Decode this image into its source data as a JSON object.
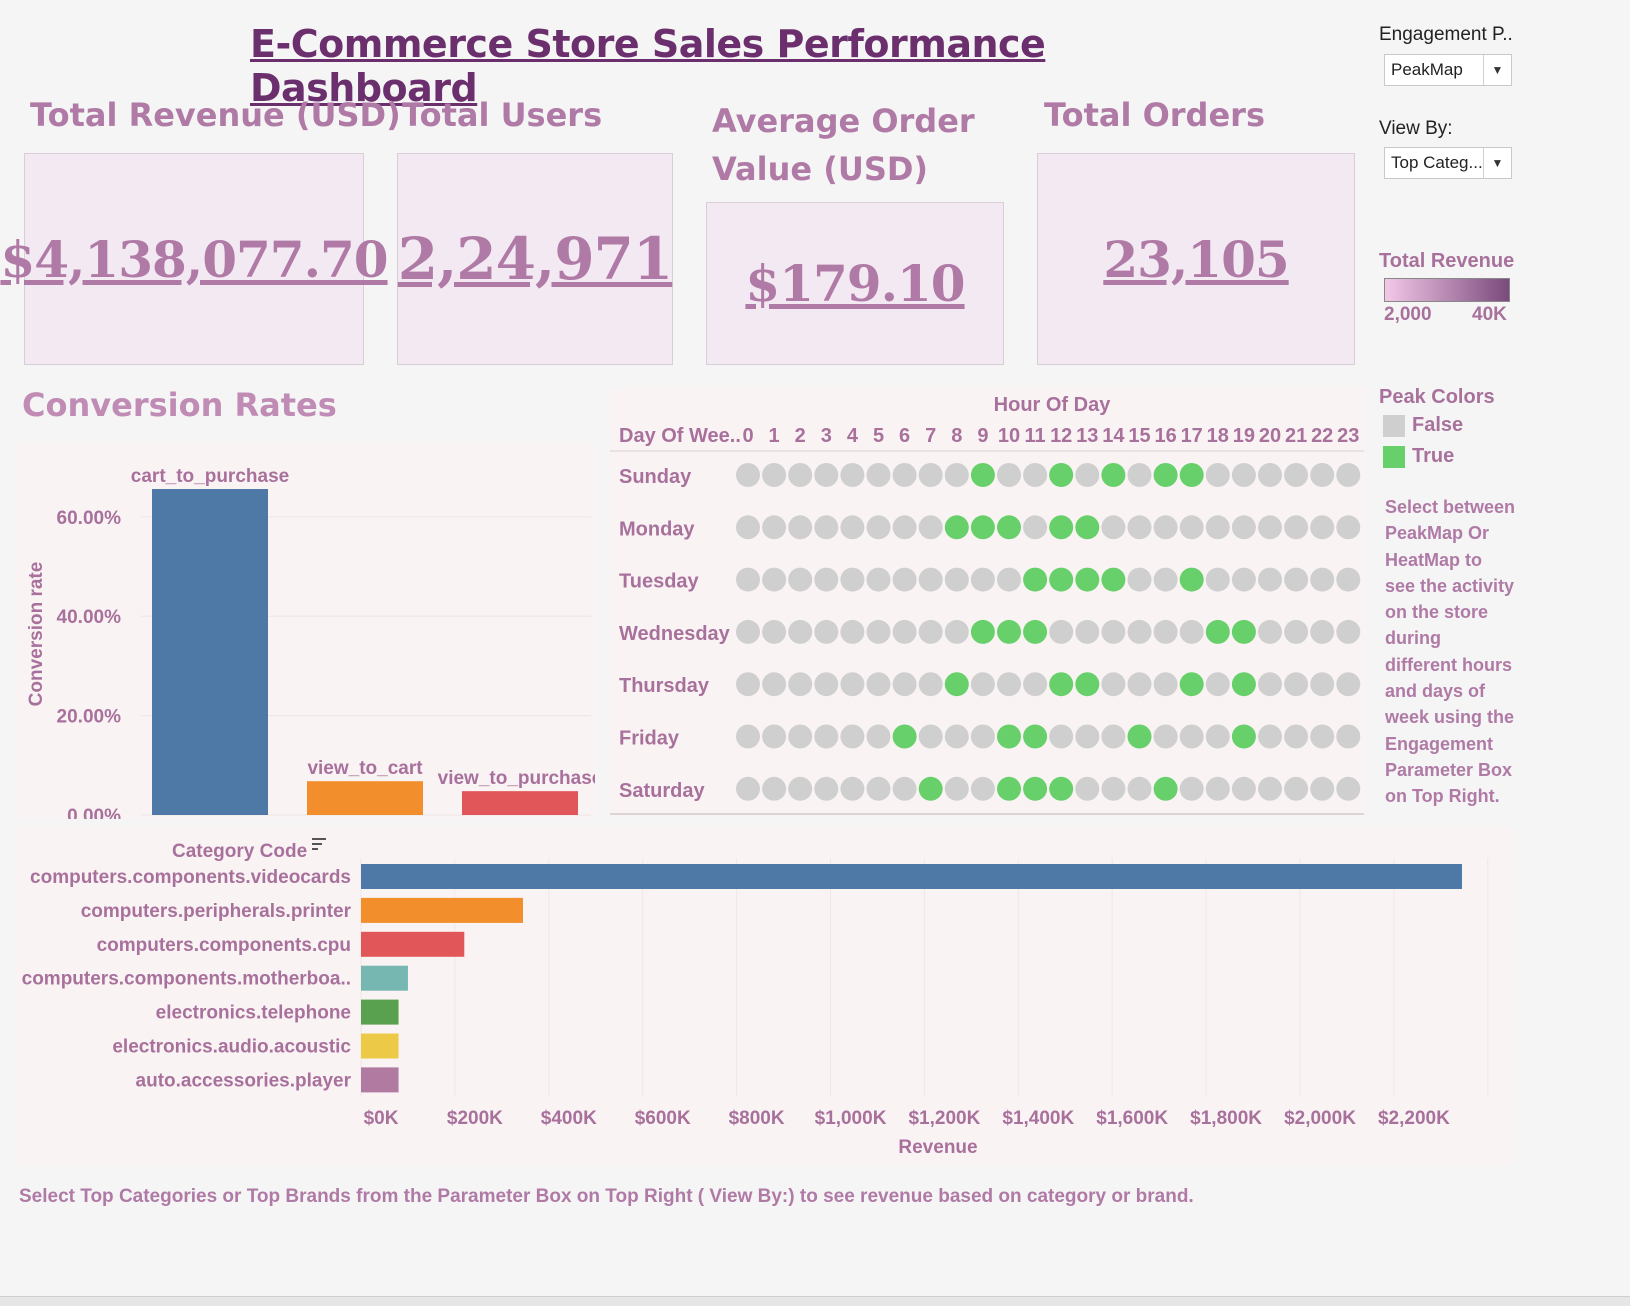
{
  "dashboard": {
    "title": "E-Commerce Store Sales Performance Dashboard",
    "footer_note": "Select Top Categories or Top Brands from the Parameter Box on Top Right ( View By:) to see revenue based on category or brand."
  },
  "kpis": {
    "revenue_label": "Total Revenue (USD)",
    "revenue_value": "$4,138,077.70",
    "users_label": "Total Users",
    "users_value": "2,24,971",
    "aov_label_line1": "Average Order",
    "aov_label_line2": "Value (USD)",
    "aov_value": "$179.10",
    "orders_label": "Total Orders",
    "orders_value": "23,105"
  },
  "parameters": {
    "engagement_label": "Engagement P..",
    "engagement_value": "PeakMap",
    "viewby_label": "View By:",
    "viewby_value": "Top Categ..."
  },
  "revenue_legend": {
    "title": "Total Revenue",
    "min_label": "2,000",
    "max_label": "40K",
    "color_from": "#f3c8e8",
    "color_to": "#7a4a7c"
  },
  "peak_legend": {
    "title": "Peak Colors",
    "false_label": "False",
    "true_label": "True",
    "false_color": "#cfcfcf",
    "true_color": "#67d06a"
  },
  "side_note": [
    "Select between",
    "PeakMap Or",
    "HeatMap to",
    "see the activity",
    "on the store",
    "during",
    "different hours",
    "and days of",
    "week using the",
    "Engagement",
    "Parameter Box",
    "on Top Right."
  ],
  "chart_data": [
    {
      "type": "bar",
      "title": "Conversion Rates",
      "ylabel": "Conversion rate",
      "xlabel": "",
      "categories": [
        "cart_to_purchase",
        "view_to_cart",
        "view_to_purchase"
      ],
      "values": [
        65.6,
        6.8,
        4.8
      ],
      "colors": [
        "#4e79a7",
        "#f28e2b",
        "#e15759"
      ],
      "yticks": [
        "0.00%",
        "20.00%",
        "40.00%",
        "60.00%"
      ],
      "ylim": [
        0,
        70
      ],
      "grid": true
    },
    {
      "type": "heatmap",
      "title": "Hour Of Day",
      "row_header": "Day Of Wee..",
      "hours": [
        "0",
        "1",
        "2",
        "3",
        "4",
        "5",
        "6",
        "7",
        "8",
        "9",
        "10",
        "11",
        "12",
        "13",
        "14",
        "15",
        "16",
        "17",
        "18",
        "19",
        "20",
        "21",
        "22",
        "23"
      ],
      "days": [
        "Sunday",
        "Monday",
        "Tuesday",
        "Wednesday",
        "Thursday",
        "Friday",
        "Saturday"
      ],
      "peaks": [
        [
          9,
          12,
          14,
          16,
          17
        ],
        [
          8,
          9,
          10,
          12,
          13
        ],
        [
          11,
          12,
          13,
          14,
          17
        ],
        [
          9,
          10,
          11,
          18,
          19
        ],
        [
          8,
          12,
          13,
          17,
          19
        ],
        [
          6,
          10,
          11,
          15,
          19
        ],
        [
          7,
          10,
          11,
          12,
          16
        ]
      ]
    },
    {
      "type": "bar",
      "orientation": "horizontal",
      "ylabel": "Category Code",
      "xlabel": "Revenue",
      "categories": [
        "computers.components.videocards",
        "computers.peripherals.printer",
        "computers.components.cpu",
        "computers.components.motherboa..",
        "electronics.telephone",
        "electronics.audio.acoustic",
        "auto.accessories.player"
      ],
      "values": [
        2345000,
        345000,
        220000,
        100000,
        80000,
        80000,
        80000
      ],
      "colors": [
        "#4e79a7",
        "#f28e2b",
        "#e15759",
        "#76b7b2",
        "#59a14f",
        "#edc948",
        "#b07aa1"
      ],
      "xticks": [
        "$0K",
        "$200K",
        "$400K",
        "$600K",
        "$800K",
        "$1,000K",
        "$1,200K",
        "$1,400K",
        "$1,600K",
        "$1,800K",
        "$2,000K",
        "$2,200K"
      ],
      "xlim": [
        0,
        2400000
      ],
      "grid": true
    }
  ]
}
